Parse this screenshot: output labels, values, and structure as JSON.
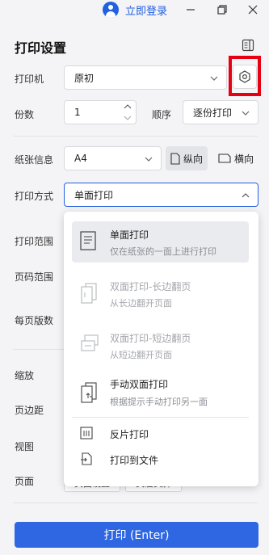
{
  "titlebar": {
    "login_label": "立即登录"
  },
  "panel": {
    "title": "打印设置"
  },
  "printer": {
    "label": "打印机",
    "value": "原初"
  },
  "copies": {
    "label": "份数",
    "value": "1",
    "order_label": "顺序",
    "order_value": "逐份打印"
  },
  "paper": {
    "label": "纸张信息",
    "size": "A4",
    "portrait": "纵向",
    "landscape": "横向"
  },
  "mode": {
    "label": "打印方式",
    "value": "单面打印"
  },
  "left_labels": {
    "range": "打印范围",
    "pages": "页码范围",
    "per_sheet": "每页版数",
    "scale": "缩放",
    "margin": "页边距",
    "view": "视图",
    "page": "页面"
  },
  "page_buttons": {
    "setup": "页面设置",
    "header_footer": "页眉页脚"
  },
  "print_button": "打印 (Enter)",
  "dropdown": {
    "items": [
      {
        "title": "单面打印",
        "sub": "仅在纸张的一面上进行打印"
      },
      {
        "title": "双面打印-长边翻页",
        "sub": "从长边翻开页面"
      },
      {
        "title": "双面打印-短边翻页",
        "sub": "从短边翻开页面"
      },
      {
        "title": "手动双面打印",
        "sub": "根据提示手动打印另一面"
      }
    ],
    "reverse": "反片打印",
    "to_file": "打印到文件"
  },
  "colors": {
    "accent": "#2160e0",
    "highlight": "#e60012"
  }
}
